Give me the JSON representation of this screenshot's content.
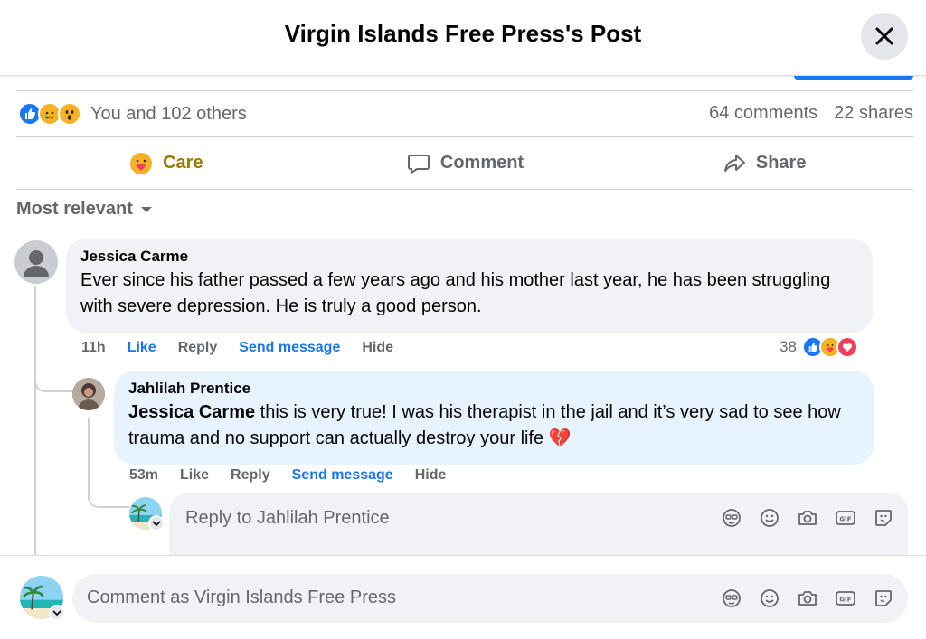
{
  "header": {
    "title": "Virgin Islands Free Press's Post"
  },
  "stats": {
    "reactions_text": "You and 102 others",
    "comments": "64 comments",
    "shares": "22 shares"
  },
  "actions": {
    "care": "Care",
    "comment": "Comment",
    "share": "Share"
  },
  "sort": {
    "label": "Most relevant"
  },
  "comment1": {
    "author": "Jessica Carme",
    "text": "Ever since his father passed a few years ago and his mother last year, he has been struggling with severe depression. He is truly a good person.",
    "time": "11h",
    "like": "Like",
    "reply": "Reply",
    "send_message": "Send message",
    "hide": "Hide",
    "reaction_count": "38"
  },
  "reply1": {
    "author": "Jahlilah Prentice",
    "mention": "Jessica Carme",
    "text": " this is very true! I was his therapist in the jail and it’s very sad to see how trauma and no support can actually destroy your life",
    "emoji": "💔",
    "time": "53m",
    "like": "Like",
    "reply": "Reply",
    "send_message": "Send message",
    "hide": "Hide"
  },
  "reply_input": {
    "placeholder": "Reply to Jahlilah Prentice"
  },
  "comment_input": {
    "placeholder": "Comment as Virgin Islands Free Press"
  },
  "colors": {
    "accent": "#1877f2",
    "care": "#9a7b00",
    "muted": "#65676b",
    "bubble": "#f0f2f5",
    "highlight_bubble": "#e7f3ff"
  },
  "icons": [
    "close-icon",
    "like-reaction-icon",
    "sad-reaction-icon",
    "wow-reaction-icon",
    "care-icon",
    "comment-icon",
    "share-icon",
    "caret-down-icon",
    "love-reaction-icon",
    "avatar-icon",
    "sticker-icon",
    "emoji-icon",
    "camera-icon",
    "gif-icon",
    "sticker-smile-icon"
  ]
}
